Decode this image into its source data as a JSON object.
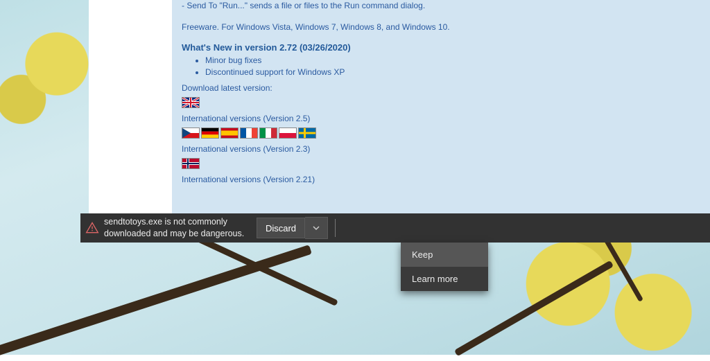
{
  "content": {
    "desc_line1": "- Send To \"Run...\" sends a file or files to the Run command dialog.",
    "desc_line2": "Freeware. For Windows Vista, Windows 7, Windows 8, and Windows 10.",
    "whats_new_heading": "What's New in version 2.72 (03/26/2020)",
    "changes": [
      "Minor bug fixes",
      "Discontinued support for Windows XP"
    ],
    "download_latest_label": "Download latest version:",
    "intl_25": "International versions (Version 2.5)",
    "intl_23": "International versions (Version 2.3)",
    "intl_221": "International versions (Version 2.21)"
  },
  "download_bar": {
    "filename": "sendtotoys.exe",
    "warning_line1": "sendtotoys.exe is not commonly",
    "warning_line2": "downloaded and may be dangerous.",
    "discard_label": "Discard",
    "menu": {
      "keep": "Keep",
      "learn_more": "Learn more"
    }
  }
}
